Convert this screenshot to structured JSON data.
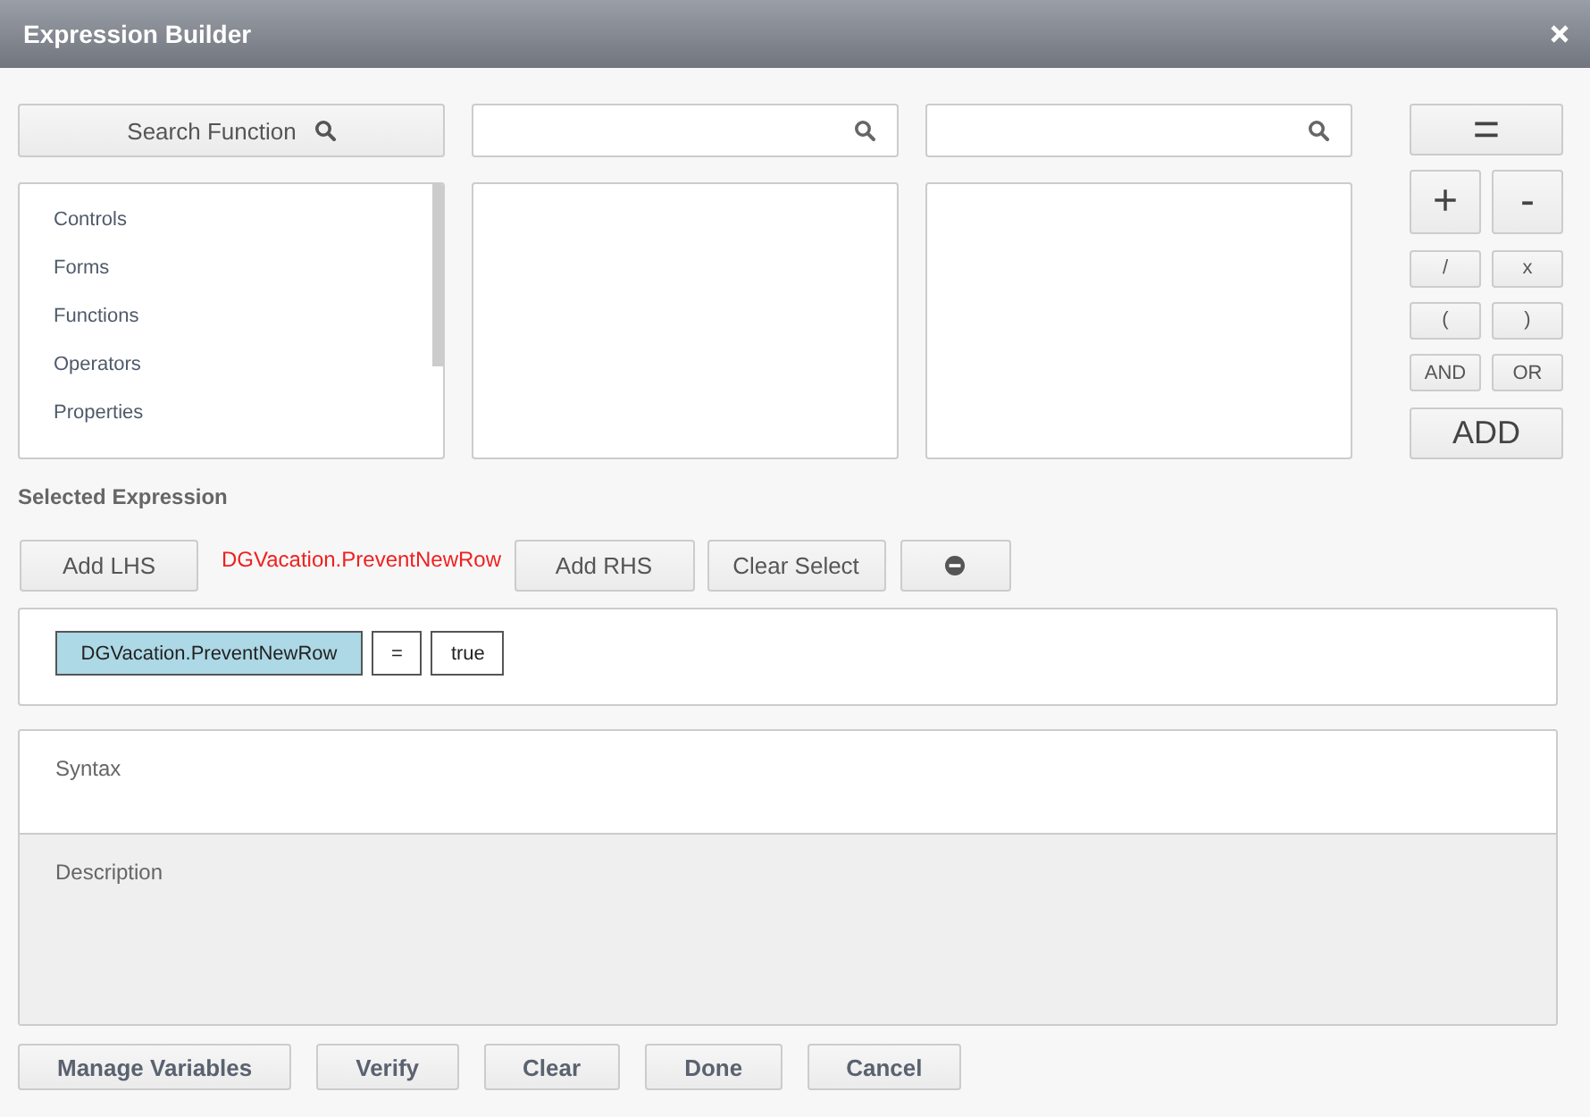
{
  "window": {
    "title": "Expression Builder"
  },
  "search_button": {
    "label": "Search Function"
  },
  "categories": [
    {
      "label": "Controls"
    },
    {
      "label": "Forms"
    },
    {
      "label": "Functions"
    },
    {
      "label": "Operators"
    },
    {
      "label": "Properties"
    }
  ],
  "operators": [
    {
      "label": "=",
      "kind": "wide"
    },
    {
      "label": "+",
      "kind": "large"
    },
    {
      "label": "-",
      "kind": "large"
    },
    {
      "label": "/",
      "kind": "small"
    },
    {
      "label": "x",
      "kind": "small"
    },
    {
      "label": "(",
      "kind": "small"
    },
    {
      "label": ")",
      "kind": "small"
    },
    {
      "label": "AND",
      "kind": "small"
    },
    {
      "label": "OR",
      "kind": "small"
    },
    {
      "label": "ADD",
      "kind": "wide"
    }
  ],
  "selected_expression": {
    "label": "Selected Expression",
    "add_lhs": "Add LHS",
    "current": "DGVacation.PreventNewRow",
    "add_rhs": "Add RHS",
    "clear_select": "Clear Select"
  },
  "expression": [
    {
      "text": "DGVacation.PreventNewRow",
      "selected": true
    },
    {
      "text": "=",
      "selected": false
    },
    {
      "text": "true",
      "selected": false
    }
  ],
  "syntax": {
    "label": "Syntax"
  },
  "description": {
    "label": "Description"
  },
  "footer_buttons": [
    "Manage Variables",
    "Verify",
    "Clear",
    "Done",
    "Cancel"
  ]
}
